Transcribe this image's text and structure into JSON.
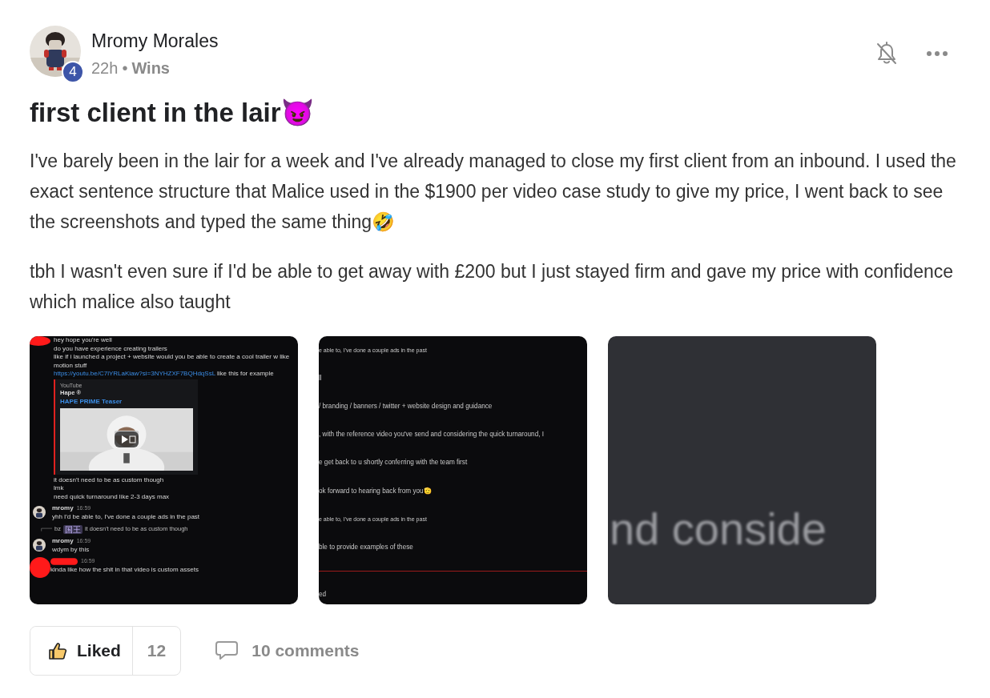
{
  "post": {
    "author": "Mromy Morales",
    "level": "4",
    "time": "22h",
    "separator": "•",
    "category": "Wins",
    "title": "first client in the lair",
    "title_emoji": "😈",
    "paragraphs": [
      "I've barely been in the lair for a week and I've already managed to close my first client from an inbound. I used the exact sentence structure that Malice used in the $1900 per video case study to give my price, I went back to see the screenshots and typed the same thing🤣",
      "tbh I wasn't even sure if I'd be able to get away with £200 but I just stayed firm and gave my price with confidence which malice also taught"
    ],
    "images": [
      {
        "kind": "chat",
        "items": [
          {
            "kind": "redacted_line",
            "text": "hey hope you're well"
          },
          {
            "kind": "line",
            "text": "do you have experience creating trailers"
          },
          {
            "kind": "line",
            "text": "like if i launched a project + website would you be able to create a cool trailer w like motion stuff"
          },
          {
            "kind": "link",
            "url": "https://youtu.be/C7lYRLaKiaw?si=3NYHZXF7BQHdqSsL",
            "text": "like this for example"
          },
          {
            "kind": "embed",
            "provider": "YouTube",
            "channel": "Hape ®",
            "title": "HAPE PRIME Teaser"
          },
          {
            "kind": "line",
            "text": "it doesn't need to be as custom though"
          },
          {
            "kind": "line",
            "text": "lmk"
          },
          {
            "kind": "line",
            "text": "need quick turnaround like 2-3 days max"
          },
          {
            "kind": "message",
            "author": "mromy",
            "time": "16:59",
            "text": "yhh I'd be able to, I've done a couple ads in the past"
          },
          {
            "kind": "reply",
            "author": "bz",
            "tag": "国王",
            "text": "it doesn't need to be as custom though"
          },
          {
            "kind": "message",
            "author": "mromy",
            "time": "16:59",
            "text": "wdym by this"
          },
          {
            "kind": "redacted_message",
            "time": "16:59",
            "text": "kinda like how the shit in that video is custom assets"
          }
        ]
      },
      {
        "kind": "cropped_chat",
        "items": [
          {
            "kind": "quote",
            "text": "e able to, I've done a couple ads in the past"
          },
          {
            "kind": "line",
            "text": "ll"
          },
          {
            "kind": "line",
            "text": "/ branding / banners / twitter + website design and guidance"
          },
          {
            "kind": "line",
            "text": ", with the reference video you've send and considering the quick turnaround, I"
          },
          {
            "kind": "line",
            "text": "e get back to u shortly conferring with the team first"
          },
          {
            "kind": "line",
            "text": "ok forward to hearing back from you🫡"
          },
          {
            "kind": "quote",
            "text": "e able to, I've done a couple ads in the past"
          },
          {
            "kind": "line",
            "text": "ble to provide examples of these"
          },
          {
            "kind": "divider"
          },
          {
            "kind": "line",
            "text": "ed"
          }
        ]
      },
      {
        "kind": "zoomed",
        "text": "nd conside"
      }
    ],
    "like": {
      "label": "Liked",
      "count": "12",
      "liked": true
    },
    "comments": "10 comments"
  }
}
